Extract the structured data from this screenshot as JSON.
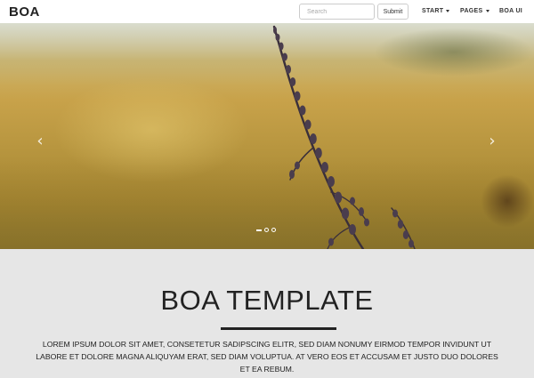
{
  "navbar": {
    "brand": "BOA",
    "search_placeholder": "Search",
    "submit_label": "Submit",
    "items": [
      {
        "label": "START",
        "has_caret": true
      },
      {
        "label": "PAGES",
        "has_caret": true
      },
      {
        "label": "BOA UI",
        "has_caret": false
      }
    ]
  },
  "carousel": {
    "prev_icon": "chevron-left-icon",
    "next_icon": "chevron-right-icon",
    "prev_glyph": "‹",
    "next_glyph": "›",
    "slide_count": 3,
    "active_slide": 1
  },
  "content": {
    "title": "BOA TEMPLATE",
    "lead": "LOREM IPSUM DOLOR SIT AMET, CONSETETUR SADIPSCING ELITR, SED DIAM NONUMY EIRMOD TEMPOR INVIDUNT UT LABORE ET DOLORE MAGNA ALIQUYAM ERAT, SED DIAM VOLUPTUA. AT VERO EOS ET ACCUSAM ET JUSTO DUO DOLORES ET EA REBUM."
  },
  "colors": {
    "content_background": "#e6e6e6",
    "text": "#222222"
  }
}
